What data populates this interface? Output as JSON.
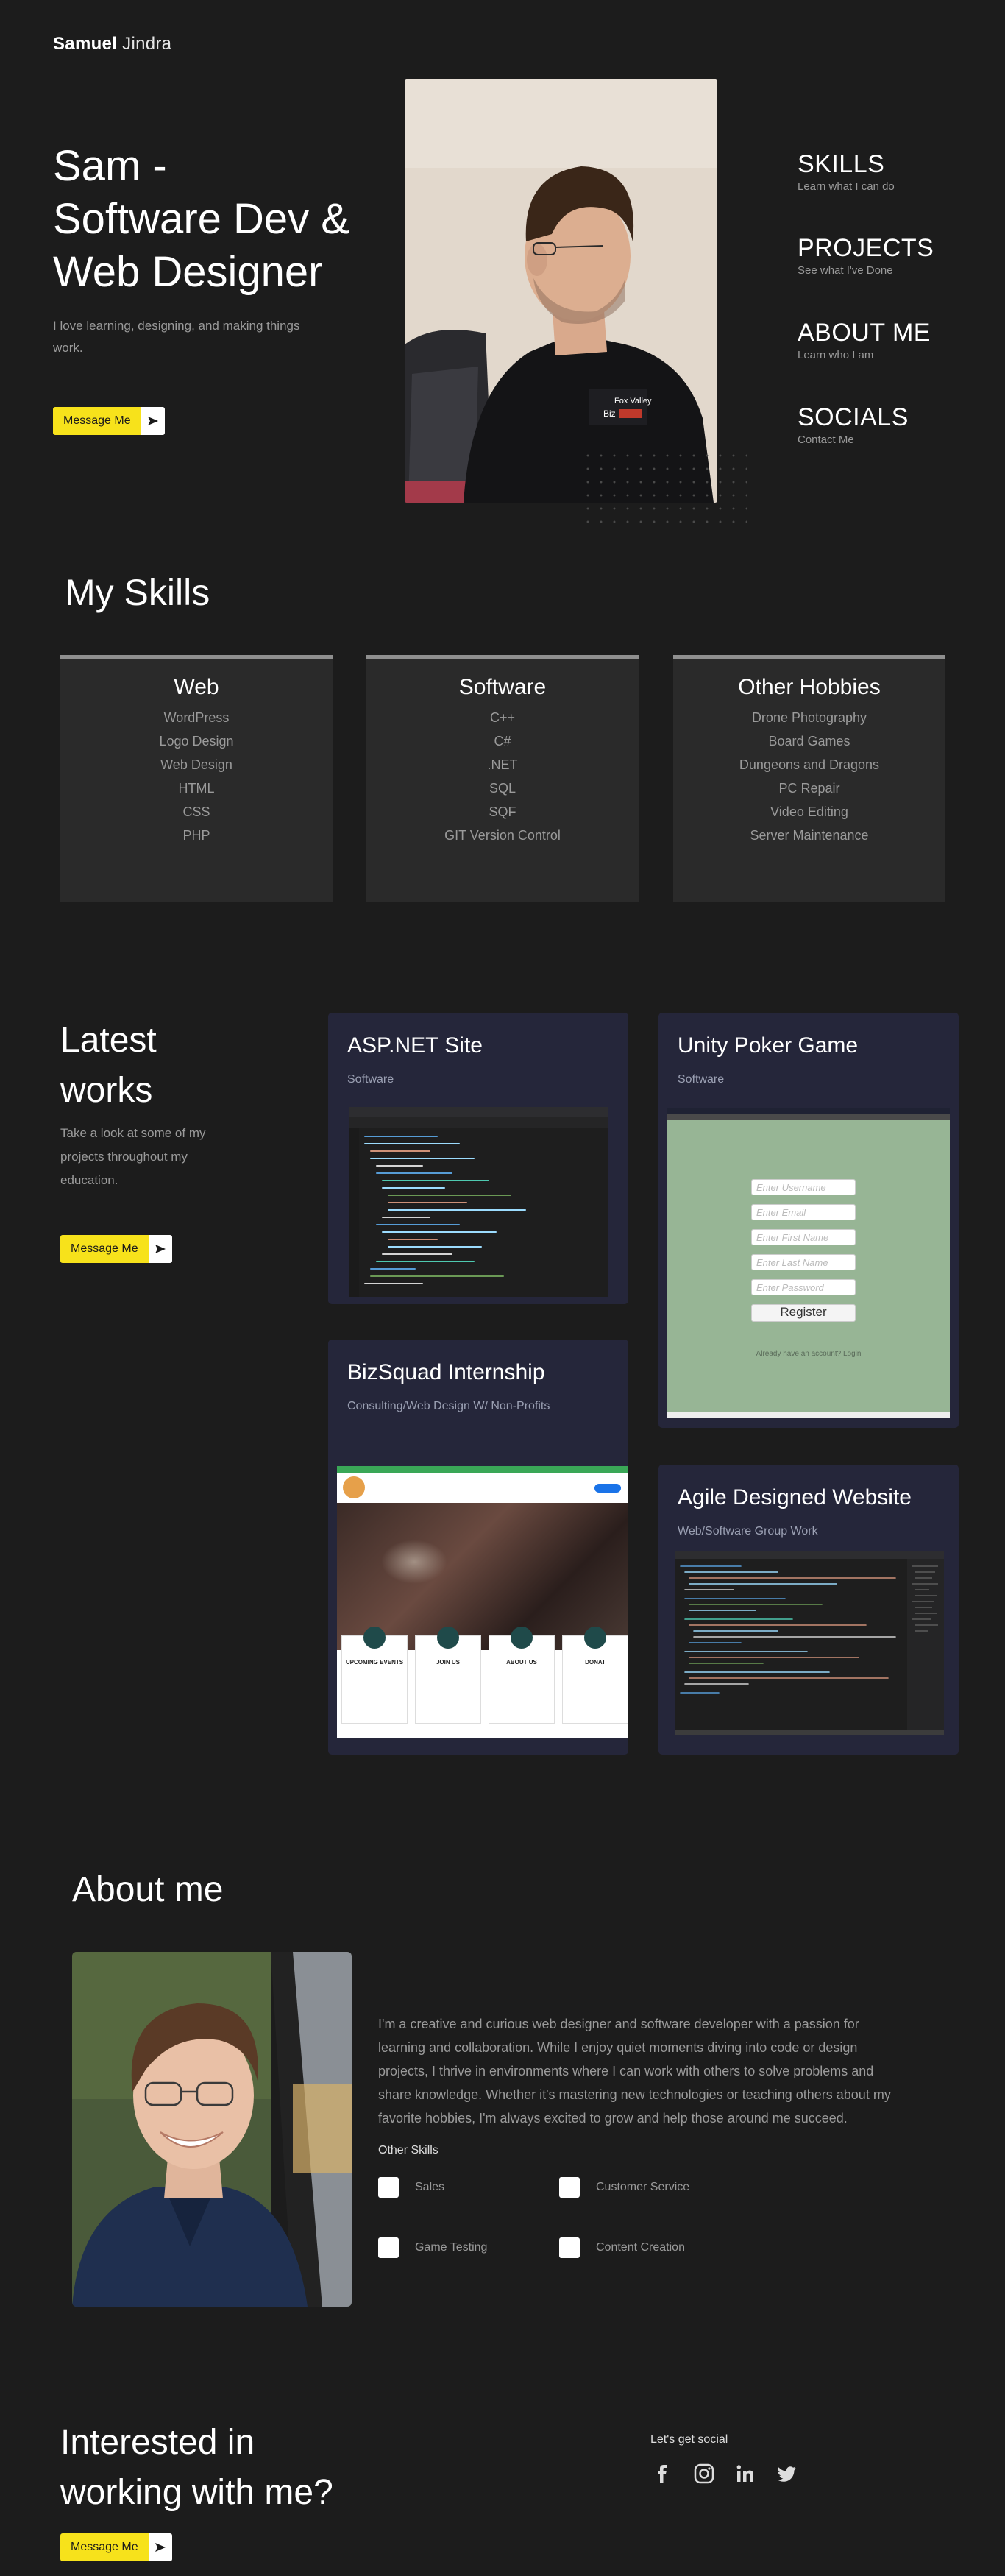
{
  "brand": {
    "first": "Samuel",
    "last": "Jindra"
  },
  "hero": {
    "title_line1": "Sam -",
    "title_line2": "Software Dev &",
    "title_line3": "Web Designer",
    "subtitle": "I love learning, designing, and making things work.",
    "button_label": "Message Me"
  },
  "nav": [
    {
      "title": "SKILLS",
      "sub": "Learn what I can do"
    },
    {
      "title": "PROJECTS",
      "sub": "See what I've Done"
    },
    {
      "title": "ABOUT ME",
      "sub": "Learn who I am"
    },
    {
      "title": "SOCIALS",
      "sub": "Contact Me"
    }
  ],
  "skills": {
    "title": "My Skills",
    "cards": [
      {
        "heading": "Web",
        "items": [
          "WordPress",
          "Logo Design",
          "Web Design",
          "HTML",
          "CSS",
          "PHP"
        ]
      },
      {
        "heading": "Software",
        "items": [
          "C++",
          "C#",
          ".NET",
          "SQL",
          "SQF",
          "GIT Version Control"
        ]
      },
      {
        "heading": "Other Hobbies",
        "items": [
          "Drone Photography",
          "Board Games",
          "Dungeons and Dragons",
          "PC Repair",
          "Video Editing",
          "Server Maintenance"
        ]
      }
    ]
  },
  "works": {
    "title_line1": "Latest",
    "title_line2": "works",
    "subtitle": "Take a look at some of my projects throughout my education.",
    "button_label": "Message Me",
    "cards": [
      {
        "title": "ASP.NET Site",
        "sub": "Software"
      },
      {
        "title": "Unity Poker Game",
        "sub": "Software"
      },
      {
        "title": "BizSquad Internship",
        "sub": "Consulting/Web Design W/ Non-Profits"
      },
      {
        "title": "Agile Designed Website",
        "sub": "Web/Software Group Work"
      }
    ],
    "unity_form": {
      "username": "Enter Username",
      "email": "Enter Email",
      "first": "Enter First Name",
      "last": "Enter Last Name",
      "password": "Enter Password",
      "register": "Register",
      "login_link": "Already have an account? Login"
    },
    "bizsquad_tiles": [
      "UPCOMING EVENTS",
      "JOIN US",
      "ABOUT US",
      "DONAT"
    ]
  },
  "about": {
    "title": "About me",
    "text": "I'm a creative and curious web designer and software developer with a passion for learning and collaboration. While I enjoy quiet moments diving into code or design projects, I thrive in environments where I can work with others to solve problems and share knowledge. Whether it's mastering new technologies or teaching others about my favorite hobbies, I'm always excited to grow and help those around me succeed.",
    "other_skills_label": "Other Skills",
    "other_skills": [
      "Sales",
      "Customer Service",
      "Game Testing",
      "Content Creation"
    ]
  },
  "contact": {
    "title_line1": "Interested in",
    "title_line2": "working with me?",
    "button_label": "Message Me",
    "social_title": "Let's get social",
    "social_icons": [
      "facebook-icon",
      "instagram-icon",
      "linkedin-icon",
      "twitter-icon"
    ]
  },
  "colors": {
    "background": "#1c1c1c",
    "accent": "#f7e21b",
    "card": "#2a2a2a",
    "work_card": "#25263a"
  }
}
